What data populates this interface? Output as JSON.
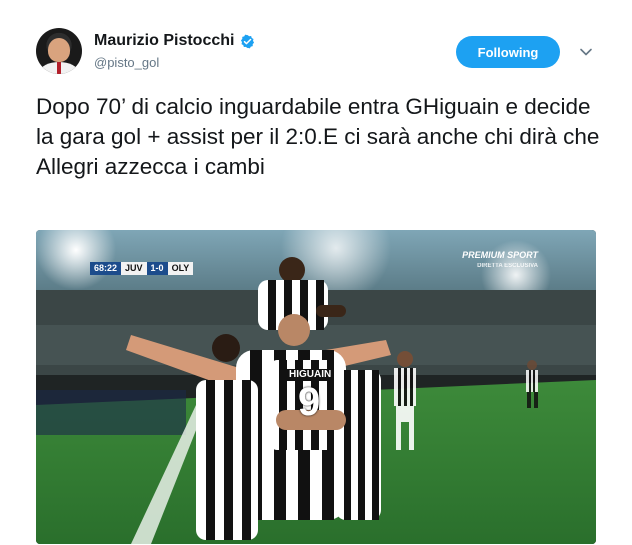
{
  "author": {
    "display_name": "Maurizio Pistocchi",
    "handle": "@pisto_gol",
    "verified": true
  },
  "actions": {
    "follow_label": "Following"
  },
  "tweet": {
    "text": "Dopo 70’ di calcio inguardabile entra GHiguain e decide la gara gol + assist per il 2:0.E ci sarà anche chi dirà che Allegri azzecca i cambi"
  },
  "media": {
    "scoreboard": {
      "clock": "68:22",
      "home": "JUV",
      "score": "1-0",
      "away": "OLY"
    },
    "broadcaster": {
      "name": "PREMIUM SPORT",
      "tag": "DIRETTA ESCLUSIVA"
    },
    "jersey": {
      "name": "HIGUAIN",
      "number": "9"
    }
  },
  "colors": {
    "accent": "#1da1f2",
    "text": "#14171a",
    "secondary": "#657786"
  },
  "icons": {
    "verified": "verified-badge-icon",
    "chevron": "chevron-down-icon"
  }
}
